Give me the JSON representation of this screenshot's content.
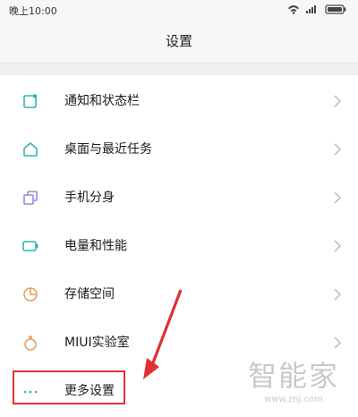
{
  "status_bar": {
    "time": "晚上10:00"
  },
  "header": {
    "title": "设置"
  },
  "items": [
    {
      "label": "通知和状态栏",
      "icon": "notification-icon"
    },
    {
      "label": "桌面与最近任务",
      "icon": "home-icon"
    },
    {
      "label": "手机分身",
      "icon": "clone-icon"
    },
    {
      "label": "电量和性能",
      "icon": "battery-icon"
    },
    {
      "label": "存储空间",
      "icon": "storage-icon"
    },
    {
      "label": "MIUI实验室",
      "icon": "lab-flask-icon"
    },
    {
      "label": "更多设置",
      "icon": "more-dots-icon"
    }
  ],
  "watermark": {
    "text": "智能家",
    "url": "www.znj.com"
  },
  "colors": {
    "accent_teal": "#2fb5a8",
    "highlight_red": "#e03131",
    "clone_purple": "#8e8fd9",
    "storage_orange": "#e3a063"
  }
}
